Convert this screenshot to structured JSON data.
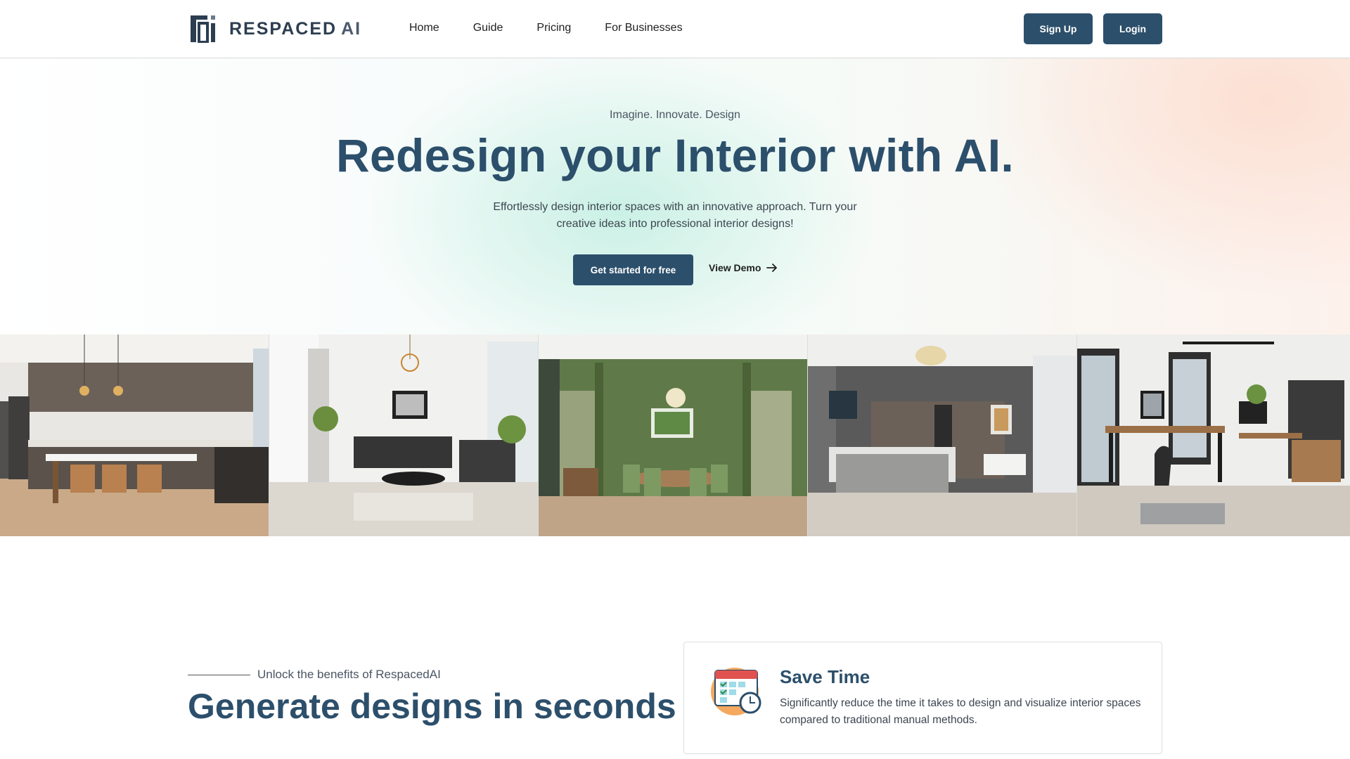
{
  "brand": {
    "name": "RESPACED",
    "suffix": "AI"
  },
  "nav": {
    "links": [
      "Home",
      "Guide",
      "Pricing",
      "For Businesses"
    ],
    "signup": "Sign Up",
    "login": "Login"
  },
  "hero": {
    "tagline": "Imagine. Innovate. Design",
    "title": "Redesign your Interior with AI.",
    "subtitle": "Effortlessly design interior spaces with an innovative approach. Turn your creative ideas into professional interior designs!",
    "cta_primary": "Get started for free",
    "cta_secondary": "View Demo"
  },
  "gallery": {
    "rooms": [
      "kitchen",
      "living-room",
      "dining-room",
      "bedroom",
      "home-office"
    ]
  },
  "benefits": {
    "eyebrow": "Unlock the benefits of RespacedAI",
    "title": "Generate designs in seconds",
    "card": {
      "icon": "calendar-clock-icon",
      "title": "Save Time",
      "text": "Significantly reduce the time it takes to design and visualize interior spaces compared to traditional manual methods."
    }
  },
  "colors": {
    "primary": "#2c4f6b",
    "text": "#3c4651"
  }
}
